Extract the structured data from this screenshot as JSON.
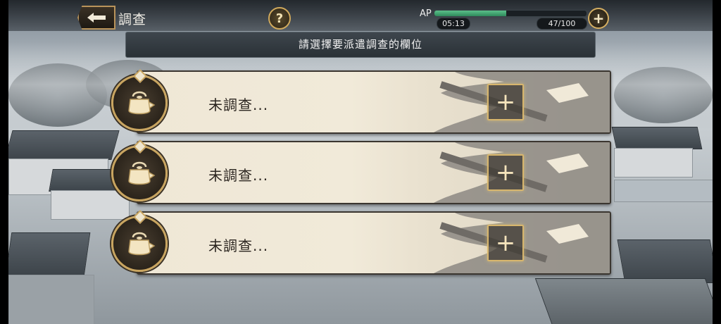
{
  "header": {
    "title": "調查",
    "back_icon": "back-arrow-icon",
    "help_label": "?",
    "ap_label": "AP",
    "ap_fill_fraction": 0.47,
    "timer": "05:13",
    "ap_value": "47/100",
    "add_label": "+"
  },
  "banner": {
    "text": "請選擇要派遣調查的欄位"
  },
  "slots": [
    {
      "status": "未調查...",
      "icon": "teapot-icon",
      "add_icon": "plus-icon",
      "add_label": "+"
    },
    {
      "status": "未調查...",
      "icon": "teapot-icon",
      "add_icon": "plus-icon",
      "add_label": "+"
    },
    {
      "status": "未調查...",
      "icon": "teapot-icon",
      "add_icon": "plus-icon",
      "add_label": "+"
    }
  ],
  "colors": {
    "accent_gold": "#c9a560",
    "ap_green": "#3fa772",
    "panel": "#efe7d6"
  }
}
